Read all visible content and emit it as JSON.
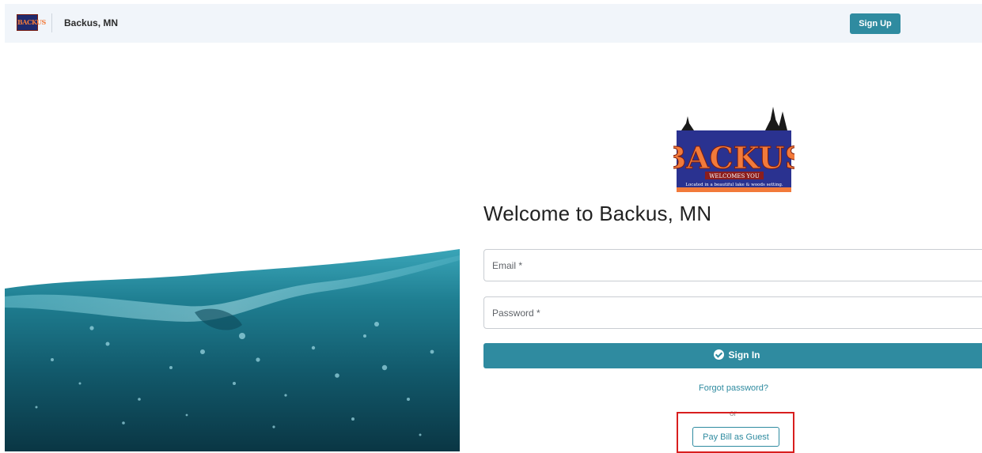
{
  "header": {
    "logo_text": "BACKUS",
    "site_title": "Backus, MN",
    "signup_label": "Sign Up"
  },
  "logo": {
    "title": "BACKUS",
    "tagline": "WELCOMES YOU",
    "subtitle": "Located in a beautiful lake & woods setting."
  },
  "login": {
    "heading": "Welcome to Backus, MN",
    "email_placeholder": "Email *",
    "password_placeholder": "Password *",
    "signin_label": "Sign In",
    "forgot_label": "Forgot password?",
    "or_label": "or",
    "guest_label": "Pay Bill as Guest"
  },
  "colors": {
    "accent": "#2f8ba0",
    "header_bg": "#f1f5fa",
    "highlight": "#d81e1e",
    "water": "#1b6f80"
  }
}
